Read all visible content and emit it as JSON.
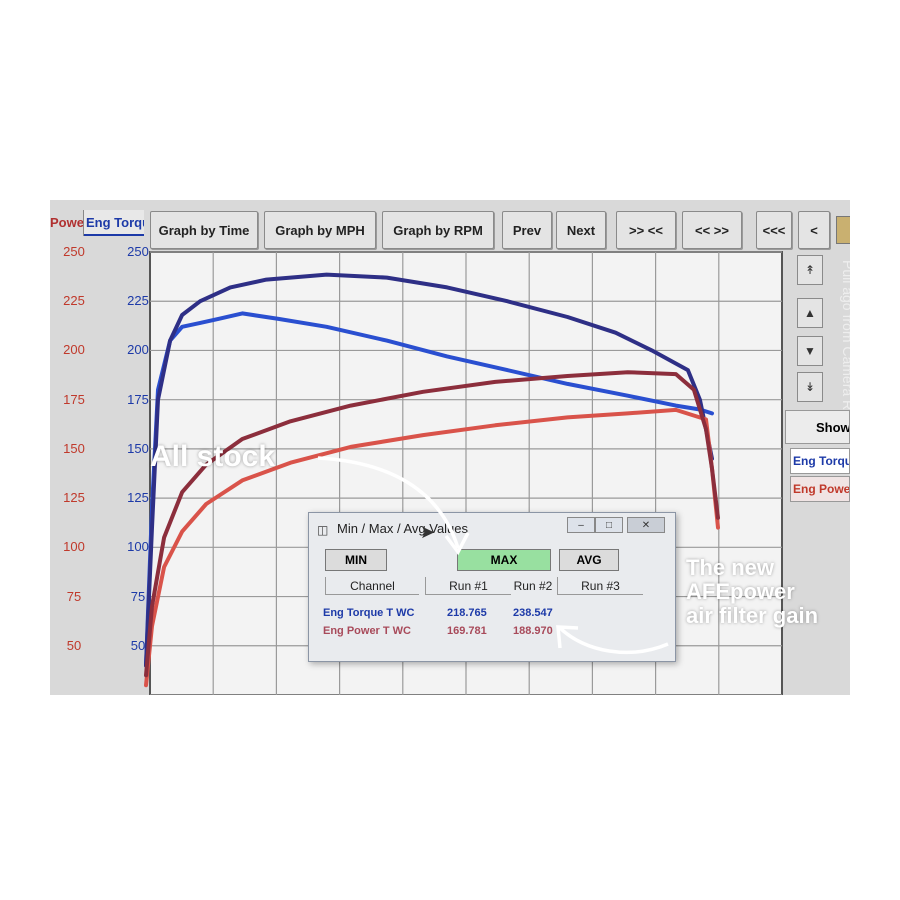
{
  "tabs": {
    "power": "Powe",
    "torque": "Eng Torqu"
  },
  "toolbar": {
    "graph_time": "Graph by Time",
    "graph_mph": "Graph by MPH",
    "graph_rpm": "Graph by RPM",
    "prev": "Prev",
    "next": "Next",
    "zoom_in": ">> <<",
    "zoom_out": "<< >>",
    "first": "<<<",
    "back": "<"
  },
  "right_panel": {
    "show": "Show",
    "channel_torque": "Eng Torque",
    "channel_power": "Eng Power",
    "vertical_text": "Pull ago from Camera Ro"
  },
  "dialog": {
    "title": "Min / Max / Avg Values",
    "min": "MIN",
    "max": "MAX",
    "avg": "AVG",
    "col_channel": "Channel",
    "col_run1": "Run #1",
    "col_run2": "Run #2",
    "col_run3": "Run #3",
    "rows": [
      {
        "channel": "Eng Torque T WC",
        "run1": "218.765",
        "run2": "238.547"
      },
      {
        "channel": "Eng Power T WC",
        "run1": "169.781",
        "run2": "188.970"
      }
    ]
  },
  "annotations": {
    "stock": "All stock",
    "new_line1": "The new",
    "new_line2": "AFEpower",
    "new_line3": "air filter gain"
  },
  "colors": {
    "torque_axis": "#1d3aa8",
    "power_axis": "#c0392b",
    "torque_stock": "#2a4fd0",
    "torque_new": "#2e2f86",
    "power_stock": "#d9534a",
    "power_new": "#8c2e3c",
    "max_button": "#98e0a0"
  },
  "chart_data": {
    "type": "line",
    "yticks_left": [
      "250",
      "225",
      "200",
      "175",
      "150",
      "125",
      "100",
      "75",
      "50"
    ],
    "yticks_right": [
      "250",
      "225",
      "200",
      "175",
      "150",
      "125",
      "100",
      "75",
      "50"
    ],
    "ylim": [
      25,
      250
    ],
    "grid": true,
    "series": [
      {
        "name": "Eng Torque T WC",
        "run": "Run #1",
        "max": 218.765,
        "x": [
          0,
          1,
          2,
          4,
          6,
          9,
          12,
          16,
          22,
          30,
          40,
          50,
          60,
          70,
          80,
          88,
          92,
          94
        ],
        "values": [
          40,
          120,
          180,
          205,
          212,
          214,
          216,
          218.8,
          216,
          212,
          205,
          197,
          190,
          183,
          177,
          172,
          170,
          168
        ]
      },
      {
        "name": "Eng Torque T WC",
        "run": "Run #2",
        "max": 238.547,
        "x": [
          0,
          1,
          2,
          4,
          6,
          9,
          14,
          20,
          30,
          40,
          50,
          60,
          70,
          78,
          84,
          90,
          92,
          93,
          94
        ],
        "values": [
          40,
          110,
          175,
          205,
          218,
          225,
          232,
          236,
          238.5,
          237,
          232,
          225,
          217,
          209,
          200,
          190,
          175,
          160,
          145
        ]
      },
      {
        "name": "Eng Power T WC",
        "run": "Run #1",
        "max": 169.781,
        "x": [
          0,
          1,
          3,
          6,
          10,
          16,
          24,
          34,
          46,
          58,
          70,
          80,
          88,
          93,
          94,
          95
        ],
        "values": [
          30,
          60,
          90,
          108,
          122,
          134,
          143,
          151,
          157,
          162,
          166,
          168,
          169.8,
          165,
          140,
          110
        ]
      },
      {
        "name": "Eng Power T WC",
        "run": "Run #2",
        "max": 188.97,
        "x": [
          0,
          1,
          3,
          6,
          10,
          16,
          24,
          34,
          46,
          58,
          70,
          80,
          88,
          91,
          93,
          94,
          95
        ],
        "values": [
          35,
          70,
          105,
          128,
          142,
          155,
          164,
          172,
          179,
          184,
          187,
          188.97,
          188,
          180,
          160,
          140,
          115
        ]
      }
    ]
  }
}
